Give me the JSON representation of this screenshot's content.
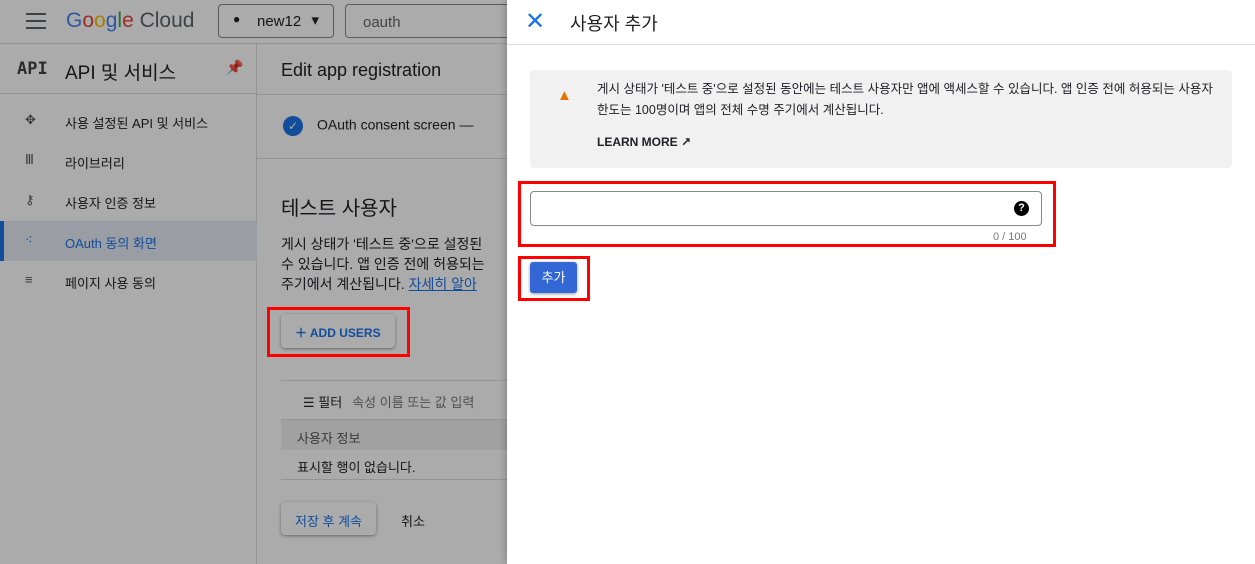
{
  "topbar": {
    "logo": "Google Cloud",
    "project": "new12",
    "search_value": "oauth"
  },
  "sidebar": {
    "icon_text": "API",
    "title": "API 및 서비스",
    "items": [
      {
        "label": "사용 설정된 API 및 서비스",
        "icon": "apis-icon"
      },
      {
        "label": "라이브러리",
        "icon": "library-icon"
      },
      {
        "label": "사용자 인증 정보",
        "icon": "key-icon"
      },
      {
        "label": "OAuth 동의 화면",
        "icon": "consent-icon",
        "selected": true
      },
      {
        "label": "페이지 사용 동의",
        "icon": "settings-list-icon"
      }
    ]
  },
  "main": {
    "title": "Edit app registration",
    "step": "OAuth consent screen",
    "section_title": "테스트 사용자",
    "para": [
      "게시 상태가 '테스트 중'으로 설정된",
      "수 있습니다. 앱 인증 전에 허용되는",
      "주기에서 계산됩니다. "
    ],
    "learn_link": "자세히 알아",
    "add_users": "ADD USERS",
    "filter_label": "필터",
    "filter_placeholder": "속성 이름 또는 값 입력",
    "column": "사용자 정보",
    "empty": "표시할 행이 없습니다.",
    "save": "저장 후 계속",
    "cancel": "취소"
  },
  "panel": {
    "title": "사용자 추가",
    "notice": "게시 상태가 '테스트 중'으로 설정된 동안에는 테스트 사용자만 앱에 액세스할 수 있습니다. 앱 인증 전에 허용되는 사용자 한도는 100명이며 앱의 전체 수명 주기에서 계산됩니다.",
    "learn_more": "LEARN MORE",
    "input_value": "",
    "counter": "0 / 100",
    "add": "추가"
  },
  "colors": {
    "accent": "#1a73e8",
    "button": "#3367d6",
    "highlight": "#ff0000",
    "warning": "#e37400"
  }
}
